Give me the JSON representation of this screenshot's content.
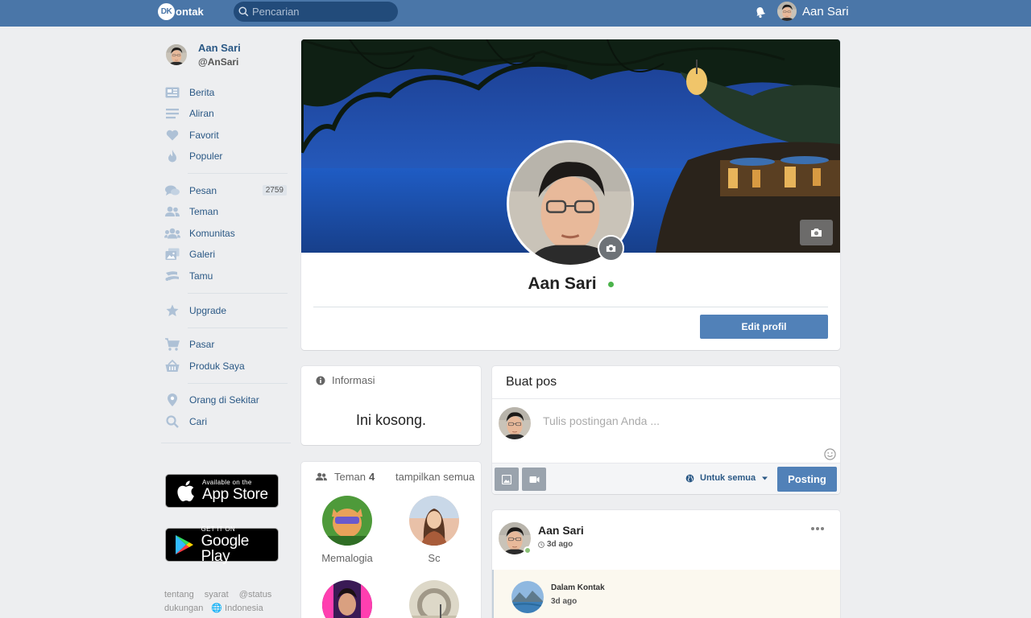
{
  "header": {
    "logo_badge": "DK",
    "logo_text": "ontak",
    "search_placeholder": "Pencarian",
    "user_name": "Aan Sari"
  },
  "sidebar": {
    "user": {
      "name": "Aan Sari",
      "handle": "@AnSari"
    },
    "items": [
      {
        "label": "Berita",
        "icon": "news-icon"
      },
      {
        "label": "Aliran",
        "icon": "stream-icon"
      },
      {
        "label": "Favorit",
        "icon": "heart-icon"
      },
      {
        "label": "Populer",
        "icon": "flame-icon"
      },
      {
        "label": "Pesan",
        "icon": "chat-icon",
        "count": "2759"
      },
      {
        "label": "Teman",
        "icon": "friends-icon"
      },
      {
        "label": "Komunitas",
        "icon": "community-icon"
      },
      {
        "label": "Galeri",
        "icon": "gallery-icon"
      },
      {
        "label": "Tamu",
        "icon": "guests-icon"
      },
      {
        "label": "Upgrade",
        "icon": "star-icon"
      },
      {
        "label": "Pasar",
        "icon": "cart-icon"
      },
      {
        "label": "Produk Saya",
        "icon": "basket-icon"
      },
      {
        "label": "Orang di Sekitar",
        "icon": "location-pin-icon"
      },
      {
        "label": "Cari",
        "icon": "search-icon"
      }
    ],
    "app_store": {
      "small": "Available on the",
      "big": "App Store"
    },
    "google_play": {
      "small": "GET IT ON",
      "big": "Google Play"
    },
    "footer": {
      "about": "tentang",
      "terms": "syarat",
      "status": "@status",
      "support": "dukungan",
      "language": "Indonesia"
    }
  },
  "profile": {
    "name": "Aan Sari",
    "online": true,
    "edit_label": "Edit profil"
  },
  "info": {
    "title": "Informasi",
    "empty_text": "Ini kosong."
  },
  "friends": {
    "title": "Teman",
    "count": "4",
    "show_all": "tampilkan semua",
    "list": [
      {
        "name": "Memalogia"
      },
      {
        "name": "Sc"
      },
      {
        "name": ""
      },
      {
        "name": ""
      }
    ]
  },
  "create_post": {
    "title": "Buat pos",
    "placeholder": "Tulis postingan Anda ...",
    "audience": "Untuk semua",
    "submit_label": "Posting"
  },
  "feed": {
    "author": "Aan Sari",
    "time": "3d ago",
    "shared": {
      "source": "Dalam Kontak",
      "time": "3d ago"
    }
  },
  "colors": {
    "brand": "#4a76a8",
    "button": "#5181b8",
    "link": "#2a5885",
    "online": "#4bb34b",
    "background": "#edeef0"
  }
}
